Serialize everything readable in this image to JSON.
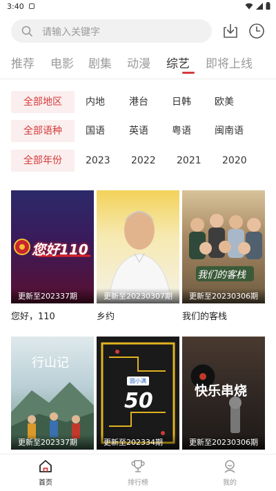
{
  "status_bar": {
    "time": "3:40"
  },
  "search": {
    "placeholder": "请输入关键字"
  },
  "tabs": [
    {
      "label": "推荐"
    },
    {
      "label": "电影"
    },
    {
      "label": "剧集"
    },
    {
      "label": "动漫"
    },
    {
      "label": "综艺",
      "active": true
    },
    {
      "label": "即将上线"
    }
  ],
  "filters": {
    "region": {
      "label": "全部地区",
      "options": [
        "内地",
        "港台",
        "日韩",
        "欧美"
      ]
    },
    "language": {
      "label": "全部语种",
      "options": [
        "国语",
        "英语",
        "粤语",
        "闽南语"
      ]
    },
    "year": {
      "label": "全部年份",
      "options": [
        "2023",
        "2022",
        "2021",
        "2020"
      ]
    }
  },
  "cards": [
    {
      "title": "您好，110",
      "update": "更新至202337期",
      "poster_text": "您好110"
    },
    {
      "title": "乡约",
      "update": "更新至20230307期"
    },
    {
      "title": "我们的客栈",
      "update": "更新至20230306期",
      "poster_text": "我们的客栈"
    },
    {
      "title": "",
      "update": "更新至202337期",
      "poster_text": "行山记"
    },
    {
      "title": "",
      "update": "更新至202334期",
      "poster_text": "50",
      "badge": "圆小满"
    },
    {
      "title": "",
      "update": "更新至20230306期",
      "poster_text": "快乐串烧"
    }
  ],
  "bottom_nav": [
    {
      "label": "首页",
      "icon": "home-icon",
      "active": true
    },
    {
      "label": "排行榜",
      "icon": "trophy-icon"
    },
    {
      "label": "我的",
      "icon": "profile-icon"
    }
  ],
  "colors": {
    "accent": "#d43a3a",
    "chip_bg": "#fbeeee",
    "muted_text": "#9a9a9a"
  }
}
